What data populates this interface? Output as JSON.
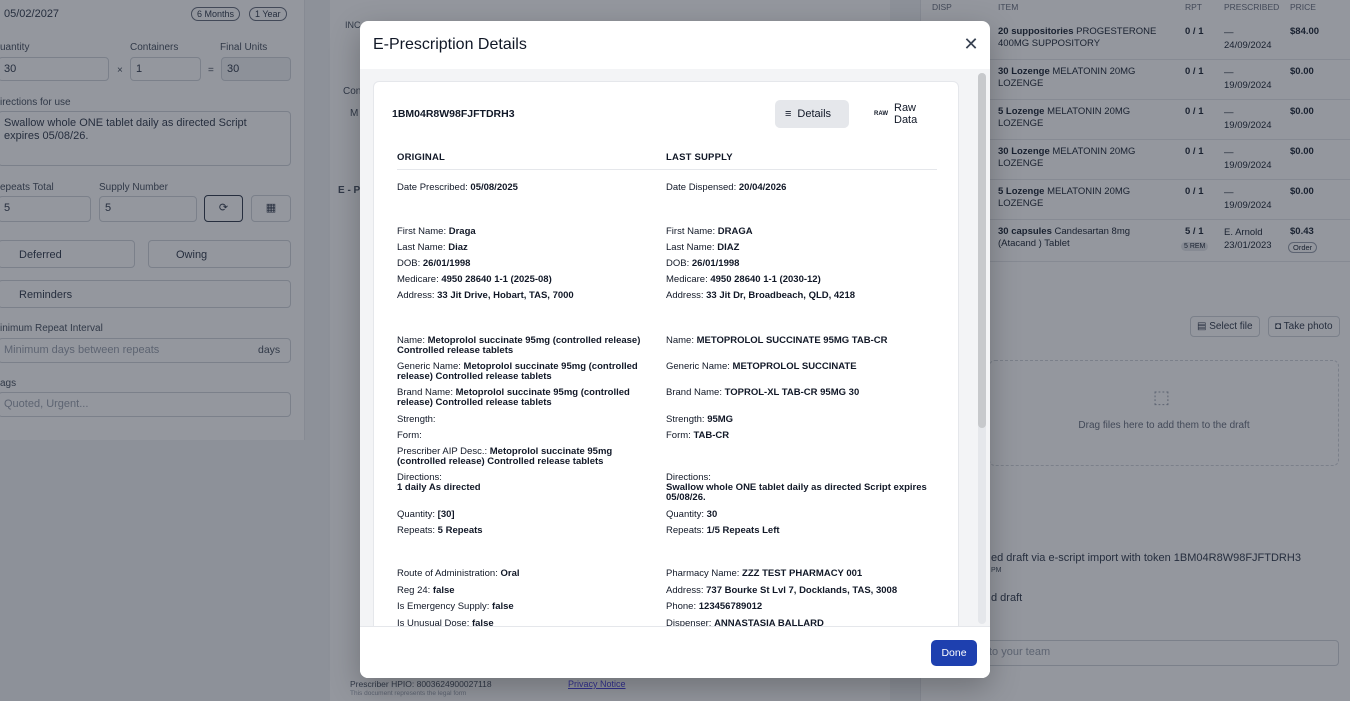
{
  "background": {
    "left": {
      "date_value": "05/02/2027",
      "pill_6m": "6 Months",
      "pill_1y": "1 Year",
      "quantity_label": "uantity",
      "containers_label": "Containers",
      "final_units_label": "Final Units",
      "quantity_value": "30",
      "containers_value": "1",
      "final_units_value": "30",
      "times_sign": "×",
      "equals_sign": "=",
      "directions_label": "irections for use",
      "directions_value": "Swallow whole ONE tablet daily as directed Script expires 05/08/26.",
      "repeats_total_label": "epeats Total",
      "supply_number_label": "Supply Number",
      "repeats_total_value": "5",
      "supply_number_value": "5",
      "deferred_label": "Deferred",
      "owing_label": "Owing",
      "reminders_label": "Reminders",
      "min_repeat_label": "inimum Repeat Interval",
      "min_repeat_placeholder": "Minimum days between repeats",
      "days_suffix": "days",
      "tags_label": "ags",
      "tags_placeholder": "Quoted, Urgent..."
    },
    "middle": {
      "ino_label": "INC",
      "con_label": "Con",
      "m_label": "M",
      "ep_label": "E - P",
      "prescriber_hpio": "Prescriber HPIO: 8003624900027118",
      "legal_form": "This document represents the legal form",
      "privacy_notice": "Privacy Notice"
    },
    "right": {
      "headers": [
        "DISP",
        "ITEM",
        "RPT",
        "PRESCRIBED",
        "PRICE"
      ],
      "rows": [
        {
          "item_bold": "20 suppositories",
          "item": "PROGESTERONE 400MG SUPPOSITORY",
          "rpt": "0 / 1",
          "prescribed": "—\n24/09/2024",
          "price": "$84.00"
        },
        {
          "item_bold": "30 Lozenge",
          "item": "MELATONIN 20MG LOZENGE",
          "rpt": "0 / 1",
          "prescribed": "—\n19/09/2024",
          "price": "$0.00"
        },
        {
          "item_bold": "5 Lozenge",
          "item": "MELATONIN 20MG LOZENGE",
          "rpt": "0 / 1",
          "prescribed": "—\n19/09/2024",
          "price": "$0.00"
        },
        {
          "item_bold": "30 Lozenge",
          "item": "MELATONIN 20MG LOZENGE",
          "rpt": "0 / 1",
          "prescribed": "—\n19/09/2024",
          "price": "$0.00"
        },
        {
          "item_bold": "5 Lozenge",
          "item": "MELATONIN 20MG LOZENGE",
          "rpt": "0 / 1",
          "prescribed": "—\n19/09/2024",
          "price": "$0.00"
        },
        {
          "item_bold": "30 capsules",
          "item": "Candesartan 8mg (Atacand ) Tablet",
          "rpt": "5 / 1",
          "prescribed": "E. Arnold\n23/01/2023",
          "price": "$0.43"
        }
      ],
      "rem_badge": "5 REM",
      "order_badge": "Order",
      "select_file": "Select file",
      "take_photo": "Take photo",
      "drop_text": "Drag files here to add them to the draft",
      "activity_1": "ed draft via e-script import with token 1BM04R8W98FJFTDRH3",
      "activity_1_time": "PM",
      "activity_2": "d draft",
      "team_placeholder": "to your team"
    }
  },
  "modal": {
    "title": "E-Prescription Details",
    "token": "1BM04R8W98FJFTDRH3",
    "tab_details": "Details",
    "tab_raw": "Raw Data",
    "raw_icon_text": "RAW",
    "col_original": "ORIGINAL",
    "col_last_supply": "LAST SUPPLY",
    "original": {
      "date_prescribed_label": "Date Prescribed:",
      "date_prescribed": "05/08/2025",
      "first_name_label": "First Name:",
      "first_name": "Draga",
      "last_name_label": "Last Name:",
      "last_name": "Diaz",
      "dob_label": "DOB:",
      "dob": "26/01/1998",
      "medicare_label": "Medicare:",
      "medicare": "4950 28640 1-1 (2025-08)",
      "address_label": "Address:",
      "address": "33 Jit Drive, Hobart, TAS, 7000",
      "name_label": "Name:",
      "name": "Metoprolol succinate 95mg (controlled release) Controlled release tablets",
      "generic_label": "Generic Name:",
      "generic": "Metoprolol succinate 95mg (controlled release) Controlled release tablets",
      "brand_label": "Brand Name:",
      "brand": "Metoprolol succinate 95mg (controlled release) Controlled release tablets",
      "strength_label": "Strength:",
      "form_label": "Form:",
      "aip_label": "Prescriber AIP Desc.:",
      "aip": "Metoprolol succinate 95mg (controlled release) Controlled release tablets",
      "directions_label": "Directions:",
      "directions": "1 daily As directed",
      "quantity_label": "Quantity:",
      "quantity": "[30]",
      "repeats_label": "Repeats:",
      "repeats": "5 Repeats",
      "route_label": "Route of Administration:",
      "route": "Oral",
      "reg24_label": "Reg 24:",
      "reg24": "false",
      "emergency_label": "Is Emergency Supply:",
      "emergency": "false",
      "unusual_label": "Is Unusual Dose:",
      "unusual": "false"
    },
    "last_supply": {
      "date_dispensed_label": "Date Dispensed:",
      "date_dispensed": "20/04/2026",
      "first_name_label": "First Name:",
      "first_name": "DRAGA",
      "last_name_label": "Last Name:",
      "last_name": "DIAZ",
      "dob_label": "DOB:",
      "dob": "26/01/1998",
      "medicare_label": "Medicare:",
      "medicare": "4950 28640 1-1 (2030-12)",
      "address_label": "Address:",
      "address": "33 Jit Dr, Broadbeach, QLD, 4218",
      "name_label": "Name:",
      "name": "METOPROLOL SUCCINATE 95MG TAB-CR",
      "generic_label": "Generic Name:",
      "generic": "METOPROLOL SUCCINATE",
      "brand_label": "Brand Name:",
      "brand": "TOPROL-XL TAB-CR 95MG 30",
      "strength_label": "Strength:",
      "strength": "95MG",
      "form_label": "Form:",
      "form": "TAB-CR",
      "directions_label": "Directions:",
      "directions": "Swallow whole ONE tablet daily as directed Script expires 05/08/26.",
      "quantity_label": "Quantity:",
      "quantity": "30",
      "repeats_label": "Repeats:",
      "repeats": "1/5 Repeats Left",
      "pharmacy_label": "Pharmacy Name:",
      "pharmacy": "ZZZ TEST PHARMACY 001",
      "address2_label": "Address:",
      "address2": "737 Bourke St Lvl 7, Docklands, TAS, 3008",
      "phone_label": "Phone:",
      "phone": "123456789012",
      "dispenser_label": "Dispenser:",
      "dispenser": "ANNASTASIA BALLARD"
    },
    "done_label": "Done"
  }
}
